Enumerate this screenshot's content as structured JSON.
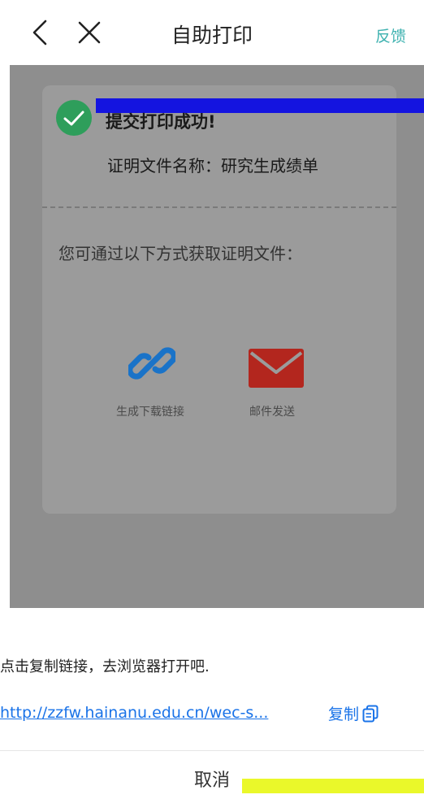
{
  "nav": {
    "title": "自助打印",
    "feedback_label": "反馈",
    "back_icon": "chevron-left-icon",
    "close_icon": "close-icon"
  },
  "dialog": {
    "success_message": "提交打印成功!",
    "file_name": "证明文件名称：研究生成绩单",
    "ways_label": "您可通过以下方式获取证明文件：",
    "options": [
      {
        "label": "生成下载链接",
        "icon": "link-icon",
        "color": "#1a73c8"
      },
      {
        "label": "邮件发送",
        "icon": "mail-icon",
        "color": "#b3261e"
      }
    ],
    "success_icon_color": "#2e9e5b"
  },
  "sheet": {
    "tip": "点击复制链接，去浏览器打开吧.",
    "url": "http://zzfw.hainanu.edu.cn/wec-s...",
    "copy_label": "复制",
    "cancel_label": "取消"
  },
  "colors": {
    "accent": "#3fb2b0",
    "link": "#1a73e8"
  }
}
